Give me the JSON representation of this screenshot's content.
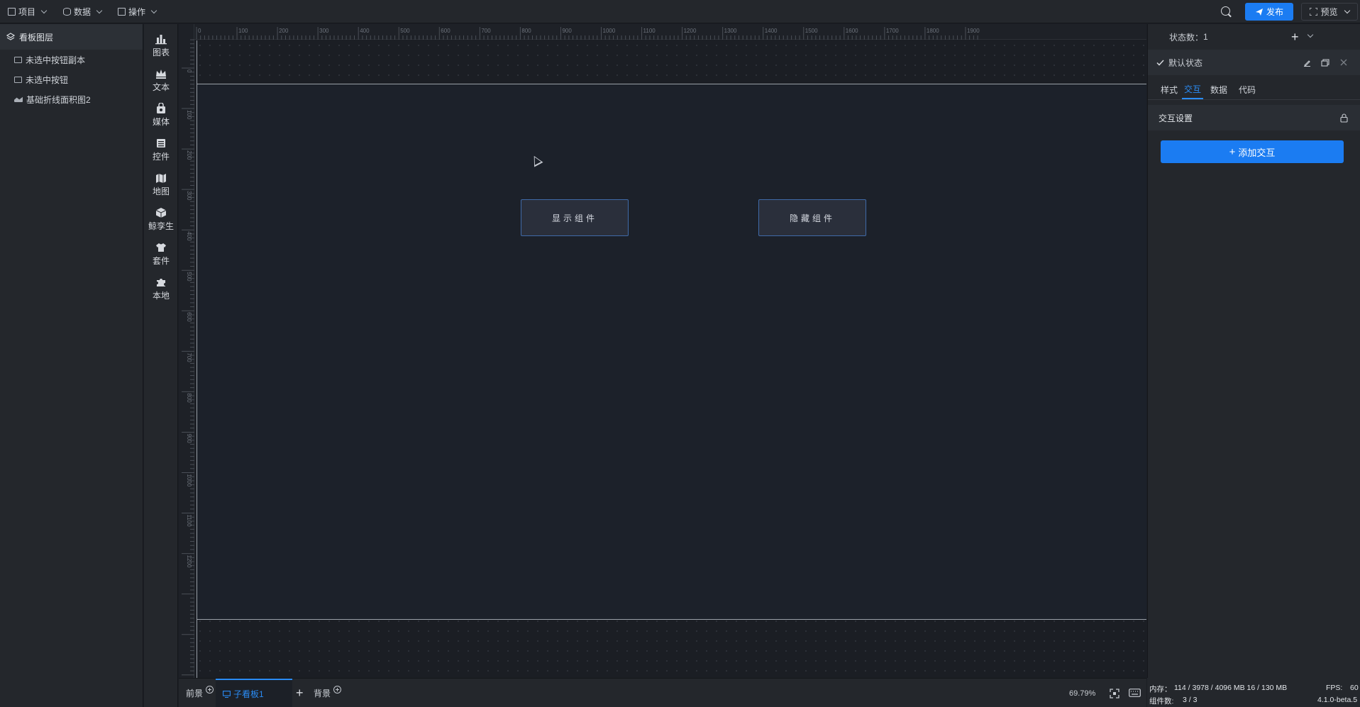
{
  "topbar": {
    "menus": [
      {
        "label": "项目",
        "icon": "document-icon"
      },
      {
        "label": "数据",
        "icon": "database-icon"
      },
      {
        "label": "操作",
        "icon": "grid-icon"
      }
    ],
    "publish_label": "发布",
    "preview_label": "预览"
  },
  "layers": {
    "title": "看板图层",
    "items": [
      {
        "label": "未选中按钮副本",
        "icon": "button-layer-icon"
      },
      {
        "label": "未选中按钮",
        "icon": "button-layer-icon"
      },
      {
        "label": "基础折线面积图2",
        "icon": "area-chart-icon"
      }
    ]
  },
  "toolbar": {
    "items": [
      {
        "label": "图表",
        "icon": "chart-icon"
      },
      {
        "label": "文本",
        "icon": "crown-icon"
      },
      {
        "label": "媒体",
        "icon": "media-icon"
      },
      {
        "label": "控件",
        "icon": "control-icon"
      },
      {
        "label": "地图",
        "icon": "map-icon"
      },
      {
        "label": "鲸孪生",
        "icon": "cube-icon"
      },
      {
        "label": "套件",
        "icon": "shirt-icon"
      },
      {
        "label": "本地",
        "icon": "puzzle-icon"
      }
    ]
  },
  "ruler": {
    "top_ticks": [
      "0",
      "100",
      "200",
      "300",
      "400",
      "500",
      "600",
      "700",
      "800",
      "900",
      "1000",
      "1100",
      "1200",
      "1300",
      "1400",
      "1500",
      "1600",
      "1700",
      "1800",
      "1900"
    ],
    "left_ticks": [
      "0",
      "100",
      "200",
      "300",
      "400",
      "500",
      "600",
      "700",
      "800",
      "900",
      "1000",
      "1100",
      "1200"
    ]
  },
  "canvas": {
    "show_button_label": "显示组件",
    "hide_button_label": "隐藏组件"
  },
  "bottombar": {
    "foreground_label": "前景",
    "active_tab_label": "子看板1",
    "background_label": "背景",
    "zoom": "69.79%"
  },
  "rpanel": {
    "state_count_label": "状态数：",
    "state_count": "1",
    "default_state_label": "默认状态",
    "tabs": [
      "样式",
      "交互",
      "数据",
      "代码"
    ],
    "active_tab": "交互",
    "section_title": "交互设置",
    "add_interaction_label": "添加交互"
  },
  "status": {
    "memory_label": "内存：",
    "memory_value": "114 / 3978 / 4096 MB  16 / 130 MB",
    "fps_label": "FPS:",
    "fps_value": "60",
    "components_label": "组件数: ",
    "components_value": "3 / 3",
    "version": "4.1.0-beta.5"
  },
  "colors": {
    "accent": "#1b7cf2",
    "panel": "#24272c",
    "canvas": "#1c212a",
    "button_border": "#3f6aa8"
  }
}
